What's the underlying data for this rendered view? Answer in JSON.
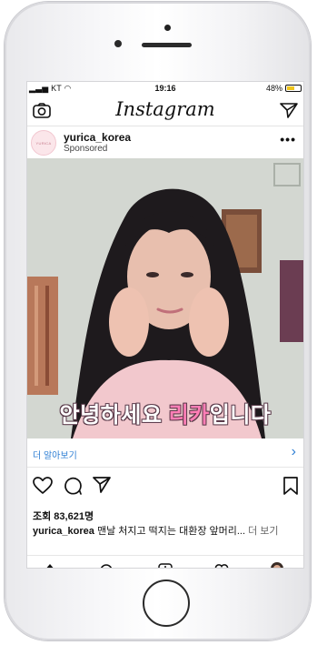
{
  "status_bar": {
    "carrier": "KT",
    "time": "19:16",
    "battery": "48%",
    "battery_level": 0.48
  },
  "app": {
    "title": "Instagram"
  },
  "post": {
    "username": "yurica_korea",
    "sponsored_label": "Sponsored",
    "avatar_text": "YURICA",
    "more_label": "•••",
    "overlay_text_main": "안녕하세요 ",
    "overlay_text_accent": "리카",
    "overlay_text_end": "입니다",
    "learn_more_label": "더 알아보기",
    "views_label": "조회 83,621명",
    "caption_username": "yurica_korea",
    "caption_text": " 맨날 처지고 떡지는 대환장 앞머리...",
    "caption_more": " 더 보기"
  },
  "icons": {
    "camera": "camera-icon",
    "direct": "send-icon",
    "like": "heart-icon",
    "comment": "comment-icon",
    "share": "send-icon",
    "save": "bookmark-icon",
    "chevron": "chevron-right-icon"
  },
  "colors": {
    "link": "#2f7fd4",
    "accent_text": "#ff7eb6",
    "battery": "#f0c419"
  }
}
